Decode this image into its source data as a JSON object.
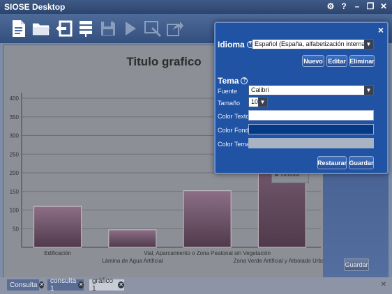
{
  "window": {
    "title": "SIOSE Desktop"
  },
  "toolbar": {
    "icons": [
      "new-document-icon",
      "open-folder-icon",
      "import-icon",
      "database-icon",
      "save-icon",
      "run-icon",
      "edit-query-icon",
      "export-icon"
    ]
  },
  "chart_data": {
    "type": "bar",
    "title": "Titulo grafico",
    "categories": [
      "Edificación",
      "Lámina de Agua Artificial",
      "Vial, Aparcamiento o Zona Peatonal sin Vegetación",
      "Zona Verde Artificial y Arbolado Urbano"
    ],
    "values": [
      110,
      47,
      152,
      382
    ],
    "ylim": [
      0,
      430
    ],
    "yticks": [
      50,
      100,
      150,
      200,
      250,
      300,
      350,
      400
    ],
    "legend_entry": "consulta",
    "legend_position": "right",
    "grid": true,
    "colors": {
      "bar": "#6e4e66"
    }
  },
  "right_panel": {
    "save_label": "Guardar"
  },
  "tabs": [
    {
      "label": "Consulta",
      "active": false
    },
    {
      "label": "consulta 1",
      "active": false
    },
    {
      "label": "gráfico 1",
      "active": true
    }
  ],
  "dialog": {
    "close_label": "×",
    "idioma": {
      "title": "Idioma",
      "help": "?",
      "selected": "Español (España, alfabetización internacional)",
      "buttons": {
        "new": "Nuevo",
        "edit": "Editar",
        "delete": "Eliminar"
      }
    },
    "tema": {
      "title": "Tema",
      "help": "?",
      "font_label": "Fuente",
      "font_value": "Calibri",
      "size_label": "Tamaño",
      "size_value": "10",
      "text_color_label": "Color Texto",
      "bg_color_label": "Color Fondo",
      "theme_color_label": "Color Tema",
      "colors": {
        "text": "#ffffff",
        "background": "#063985",
        "theme": "#a9b3c2"
      }
    },
    "buttons": {
      "restore": "Restaurar",
      "save": "Guardar"
    }
  }
}
